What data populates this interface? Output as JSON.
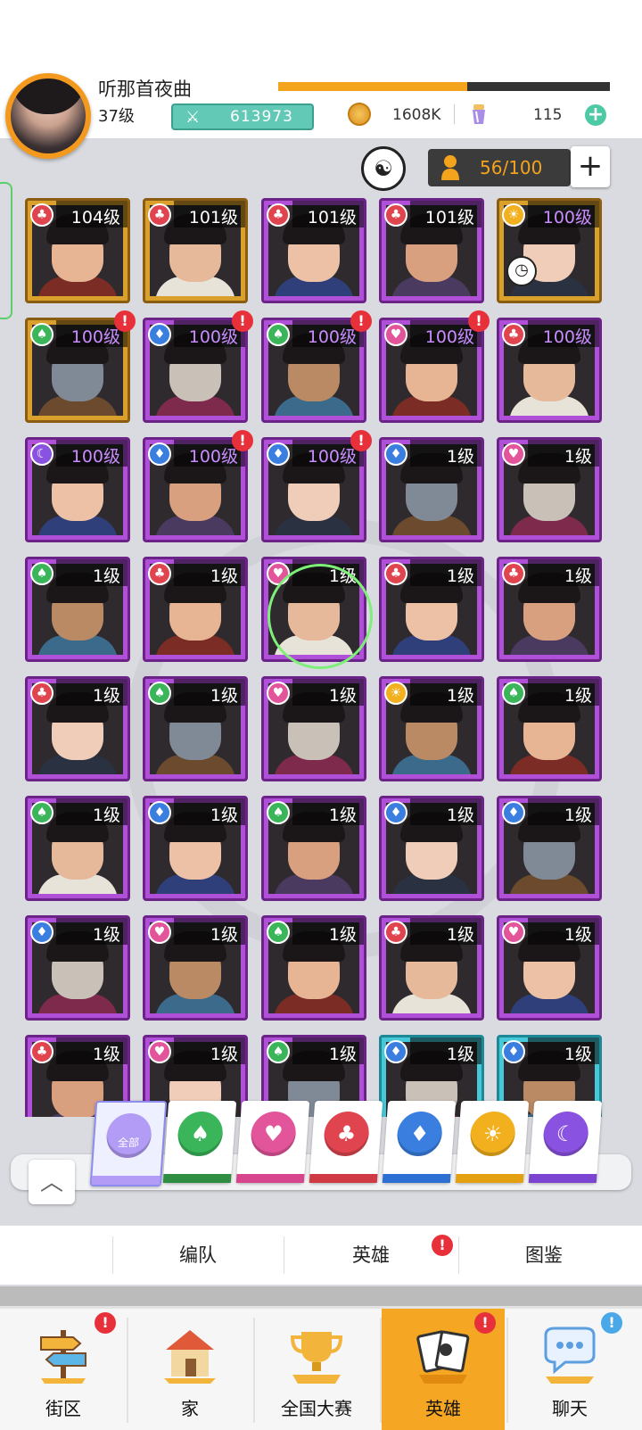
{
  "header": {
    "player_name": "听那首夜曲",
    "player_level": "37级",
    "power": "613973",
    "coins": "1608K",
    "gems": "115",
    "exp_progress": 0.57
  },
  "hero_capacity": "56/100",
  "heroes": [
    {
      "level": "104级",
      "frame": "gold",
      "faction": "red",
      "alert": false
    },
    {
      "level": "101级",
      "frame": "gold",
      "faction": "red",
      "alert": false
    },
    {
      "level": "101级",
      "frame": "purple",
      "faction": "red",
      "alert": false
    },
    {
      "level": "101级",
      "frame": "purple",
      "faction": "red",
      "alert": false
    },
    {
      "level": "100级",
      "frame": "gold",
      "faction": "sun",
      "alert": false
    },
    {
      "level": "100级",
      "frame": "gold",
      "faction": "green",
      "alert": true
    },
    {
      "level": "100级",
      "frame": "purple",
      "faction": "blue",
      "alert": true
    },
    {
      "level": "100级",
      "frame": "purple",
      "faction": "green",
      "alert": true
    },
    {
      "level": "100级",
      "frame": "purple",
      "faction": "pink",
      "alert": true
    },
    {
      "level": "100级",
      "frame": "purple",
      "faction": "red",
      "alert": false
    },
    {
      "level": "100级",
      "frame": "purple",
      "faction": "moon",
      "alert": false
    },
    {
      "level": "100级",
      "frame": "purple",
      "faction": "blue",
      "alert": true
    },
    {
      "level": "100级",
      "frame": "purple",
      "faction": "blue",
      "alert": true
    },
    {
      "level": "1级",
      "frame": "purple",
      "faction": "blue",
      "alert": false
    },
    {
      "level": "1级",
      "frame": "purple",
      "faction": "pink",
      "alert": false
    },
    {
      "level": "1级",
      "frame": "purple",
      "faction": "green",
      "alert": false
    },
    {
      "level": "1级",
      "frame": "purple",
      "faction": "red",
      "alert": false
    },
    {
      "level": "1级",
      "frame": "purple",
      "faction": "pink",
      "alert": false
    },
    {
      "level": "1级",
      "frame": "purple",
      "faction": "red",
      "alert": false
    },
    {
      "level": "1级",
      "frame": "purple",
      "faction": "red",
      "alert": false
    },
    {
      "level": "1级",
      "frame": "purple",
      "faction": "red",
      "alert": false
    },
    {
      "level": "1级",
      "frame": "purple",
      "faction": "green",
      "alert": false
    },
    {
      "level": "1级",
      "frame": "purple",
      "faction": "pink",
      "alert": false
    },
    {
      "level": "1级",
      "frame": "purple",
      "faction": "sun",
      "alert": false
    },
    {
      "level": "1级",
      "frame": "purple",
      "faction": "green",
      "alert": false
    },
    {
      "level": "1级",
      "frame": "purple",
      "faction": "green",
      "alert": false
    },
    {
      "level": "1级",
      "frame": "purple",
      "faction": "blue",
      "alert": false
    },
    {
      "level": "1级",
      "frame": "purple",
      "faction": "green",
      "alert": false
    },
    {
      "level": "1级",
      "frame": "purple",
      "faction": "blue",
      "alert": false
    },
    {
      "level": "1级",
      "frame": "purple",
      "faction": "blue",
      "alert": false
    },
    {
      "level": "1级",
      "frame": "purple",
      "faction": "blue",
      "alert": false
    },
    {
      "level": "1级",
      "frame": "purple",
      "faction": "pink",
      "alert": false
    },
    {
      "level": "1级",
      "frame": "purple",
      "faction": "green",
      "alert": false
    },
    {
      "level": "1级",
      "frame": "purple",
      "faction": "red",
      "alert": false
    },
    {
      "level": "1级",
      "frame": "purple",
      "faction": "pink",
      "alert": false
    },
    {
      "level": "1级",
      "frame": "purple",
      "faction": "red",
      "alert": false
    },
    {
      "level": "1级",
      "frame": "purple",
      "faction": "pink",
      "alert": false
    },
    {
      "level": "1级",
      "frame": "purple",
      "faction": "green",
      "alert": false
    },
    {
      "level": "1级",
      "frame": "cyan",
      "faction": "blue",
      "alert": false
    },
    {
      "level": "1级",
      "frame": "cyan",
      "faction": "blue",
      "alert": false
    }
  ],
  "faction_colors": {
    "red": "#e0454f",
    "green": "#3ab55a",
    "blue": "#3a7fe0",
    "pink": "#e3559b",
    "sun": "#f2b01e",
    "moon": "#8a52e0"
  },
  "filters": [
    {
      "id": "all",
      "label": "全部",
      "color": "#b39cf5",
      "band": "#b39cf5",
      "selected": true
    },
    {
      "id": "green",
      "color": "#3ab55a",
      "band": "#2e8c43",
      "selected": false
    },
    {
      "id": "pink",
      "color": "#e3559b",
      "band": "#d7468d",
      "selected": false
    },
    {
      "id": "red",
      "color": "#e0454f",
      "band": "#cf3a44",
      "selected": false
    },
    {
      "id": "blue",
      "color": "#3a7fe0",
      "band": "#2d6fd3",
      "selected": false
    },
    {
      "id": "sun",
      "color": "#f2b01e",
      "band": "#e3a010",
      "selected": false
    },
    {
      "id": "moon",
      "color": "#8a52e0",
      "band": "#7b45d2",
      "selected": false
    }
  ],
  "subtabs": [
    {
      "label": "编队",
      "alert": false
    },
    {
      "label": "英雄",
      "alert": true
    },
    {
      "label": "图鉴",
      "alert": false
    }
  ],
  "bottom_nav": [
    {
      "label": "街区",
      "icon": "signpost-icon",
      "active": false,
      "badge": "!"
    },
    {
      "label": "家",
      "icon": "house-icon",
      "active": false,
      "badge": ""
    },
    {
      "label": "全国大赛",
      "icon": "trophy-icon",
      "active": false,
      "badge": ""
    },
    {
      "label": "英雄",
      "icon": "hero-cards-icon",
      "active": true,
      "badge": "!"
    },
    {
      "label": "聊天",
      "icon": "chat-bubble-icon",
      "active": false,
      "badge": "!"
    }
  ]
}
